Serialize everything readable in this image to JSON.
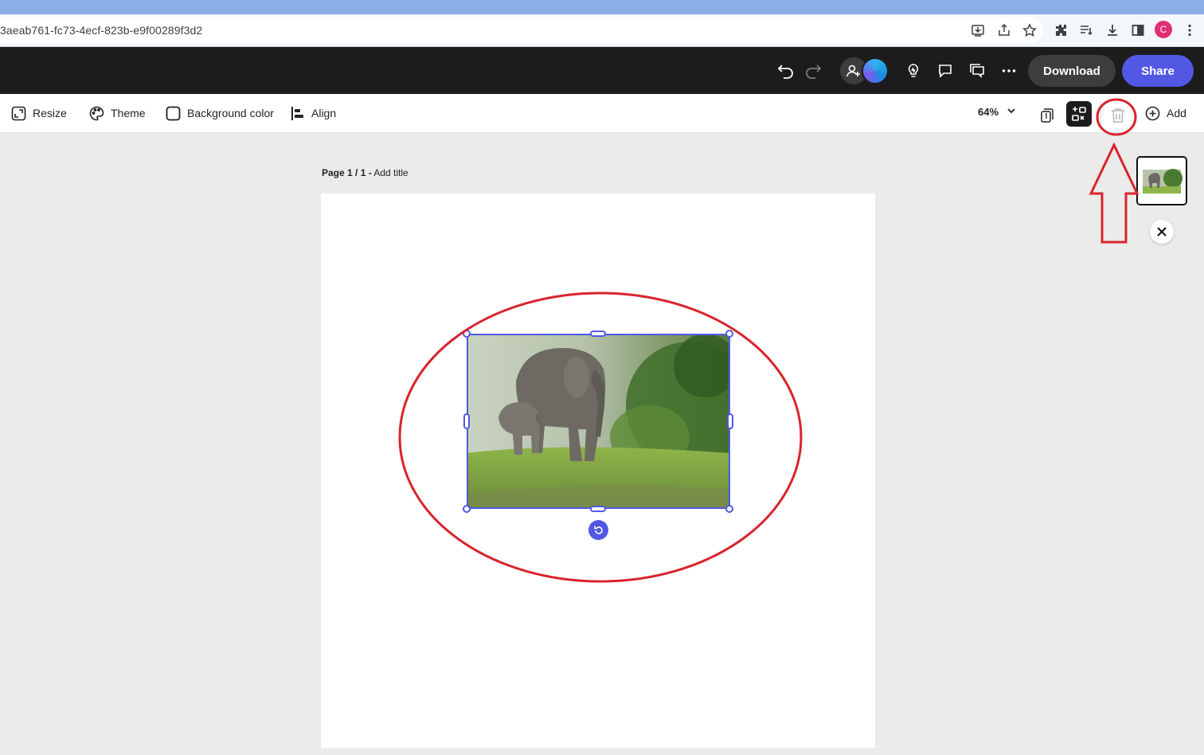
{
  "browser": {
    "url": "3aeab761-fc73-4ecf-823b-e9f00289f3d2",
    "profile_initial": "C",
    "icons": [
      "install-icon",
      "share-icon",
      "bookmark-star-icon",
      "extensions-icon",
      "reading-list-icon",
      "downloads-icon",
      "side-panel-icon",
      "menu-icon"
    ]
  },
  "header": {
    "download_label": "Download",
    "share_label": "Share",
    "icons": [
      "undo-icon",
      "redo-icon",
      "invite-icon",
      "lightbulb-icon",
      "comment-icon",
      "comments-list-icon",
      "more-icon"
    ],
    "share_color": "#5258e4"
  },
  "toolbar": {
    "resize_label": "Resize",
    "theme_label": "Theme",
    "background_label": "Background color",
    "align_label": "Align",
    "zoom": "64%",
    "add_label": "Add"
  },
  "canvas": {
    "page_label": "Page 1 / 1 -",
    "page_title_placeholder": "Add title",
    "image_description": "elephant photo",
    "selection_color": "#5258e4"
  },
  "annotation_color": "#d8242c"
}
